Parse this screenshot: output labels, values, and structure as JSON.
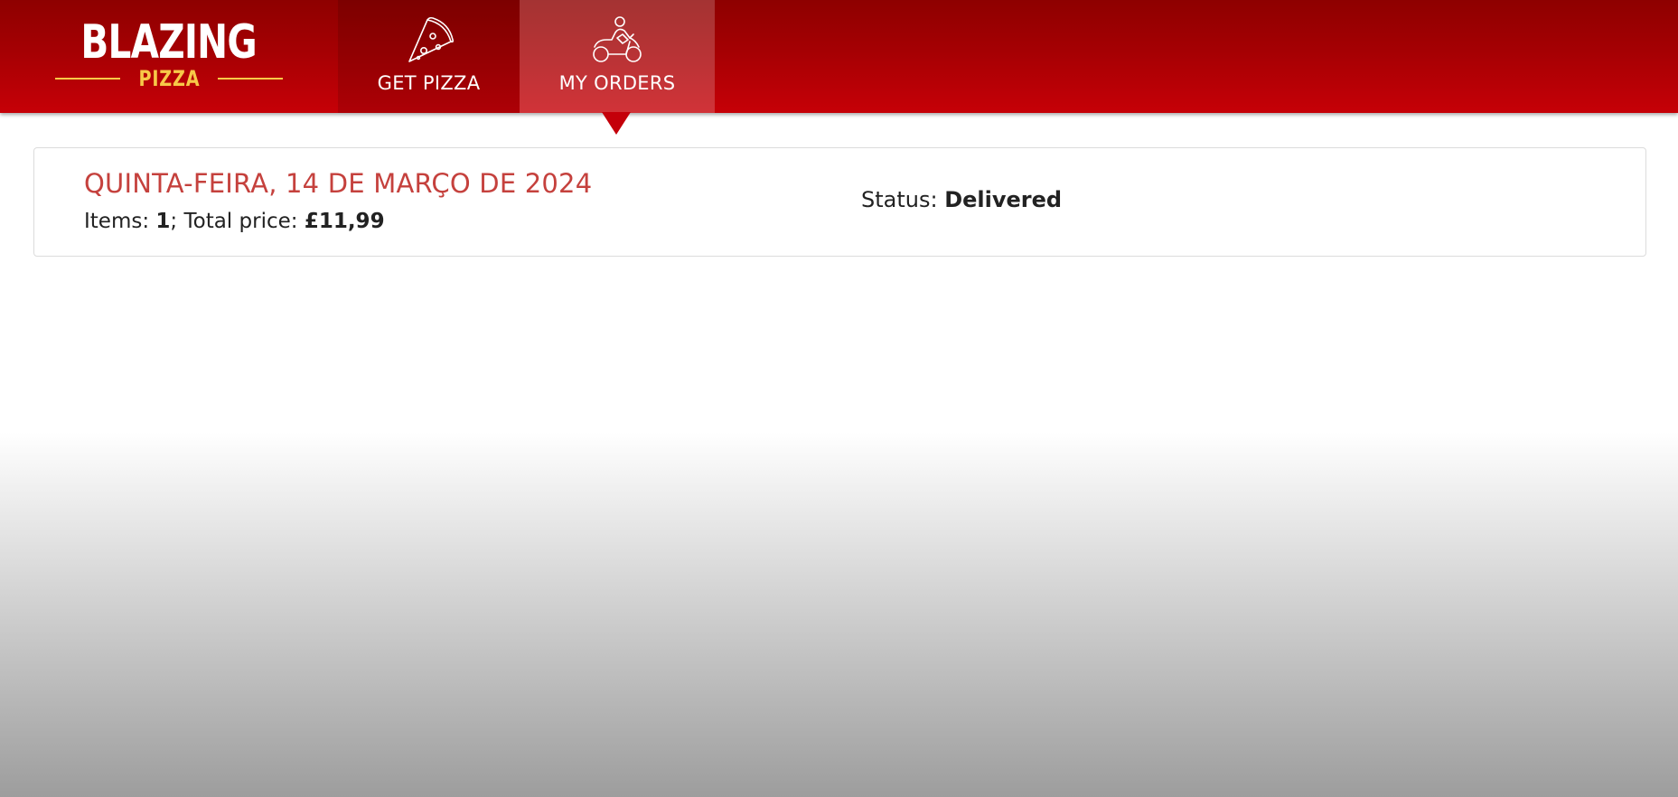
{
  "brand": {
    "name": "BLAZING",
    "sub": "PIZZA",
    "accent": "#f7c948",
    "header_color": "#c60007"
  },
  "nav": {
    "items": [
      {
        "label": "GET PIZZA",
        "icon": "pizza-slice-icon",
        "active": false
      },
      {
        "label": "MY ORDERS",
        "icon": "delivery-scooter-icon",
        "active": true
      }
    ]
  },
  "orders": [
    {
      "date": "QUINTA-FEIRA, 14 DE MARÇO DE 2024",
      "items_label": "Items: ",
      "items_count": "1",
      "separator": "; ",
      "total_label": "Total price: ",
      "total_price": "£11,99",
      "status_label": "Status: ",
      "status": "Delivered"
    }
  ]
}
